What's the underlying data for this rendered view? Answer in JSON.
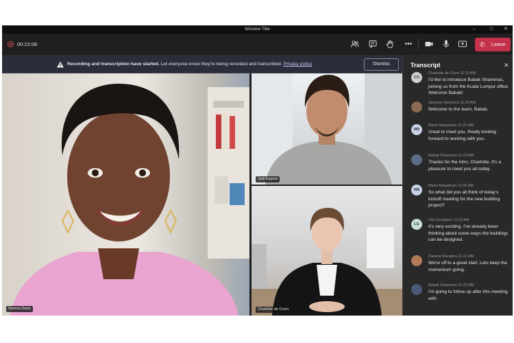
{
  "window": {
    "title": "Window Title"
  },
  "toolbar": {
    "timer": "00:22:06",
    "leave_label": "Leave",
    "icons": [
      "people-icon",
      "chat-icon",
      "raise-hand-icon",
      "more-icon",
      "camera-icon",
      "mic-icon",
      "share-icon"
    ]
  },
  "banner": {
    "bold_text": "Recording and transcription have started.",
    "text": " Let everyone know they're being recorded and transcribed. ",
    "link_text": "Privacy policy",
    "dismiss_label": "Dismiss"
  },
  "participants": [
    {
      "name": "Serena Davis"
    },
    {
      "name": "Jadi Kapoor"
    },
    {
      "name": "Charlotte de Crum"
    }
  ],
  "transcript": {
    "title": "Transcript",
    "messages": [
      {
        "initials": "CG",
        "avatar_color": "#cfcfcf",
        "meta": "Charlotte de Crum    11:19 AM",
        "text": "I'd like to introduce Babak Shammas, joining us from the Kuala Lumpur office. Welcome Babak!"
      },
      {
        "initials": "",
        "avatar_color": "#8a6a52",
        "meta": "Jazmine Simmons   11:23 AM",
        "text": "Welcome to the team, Babak."
      },
      {
        "initials": "MB",
        "avatar_color": "#c8d2e6",
        "meta": "Marie Beaudouin    11:22 AM",
        "text": "Great to meet you. Really looking forward to working with you."
      },
      {
        "initials": "",
        "avatar_color": "#5a6e86",
        "meta": "Babak Shammas    11:23 AM",
        "text": "Thanks for the intro, Charlotte. It's a pleasure to meet you all today."
      },
      {
        "initials": "MB",
        "avatar_color": "#c8d2e6",
        "meta": "Marie Beaudouin    11:22 AM",
        "text": "So what did you all think of today's kickoff meeting for the new building project?"
      },
      {
        "initials": "LG",
        "avatar_color": "#c6e0d6",
        "meta": "Lilly Georgsen    11:23 AM",
        "text": "It's very exciting. I've already been thinking about some ways the buildings can be designed."
      },
      {
        "initials": "",
        "avatar_color": "#b07a58",
        "meta": "Daniela Mandera    11:22 AM",
        "text": "We're off to a great start. Lets keep the momentum going."
      },
      {
        "initials": "",
        "avatar_color": "#4a5a78",
        "meta": "Babak Shammas    11:22 AM",
        "text": "I'm going to follow up after this meeting with"
      }
    ]
  }
}
